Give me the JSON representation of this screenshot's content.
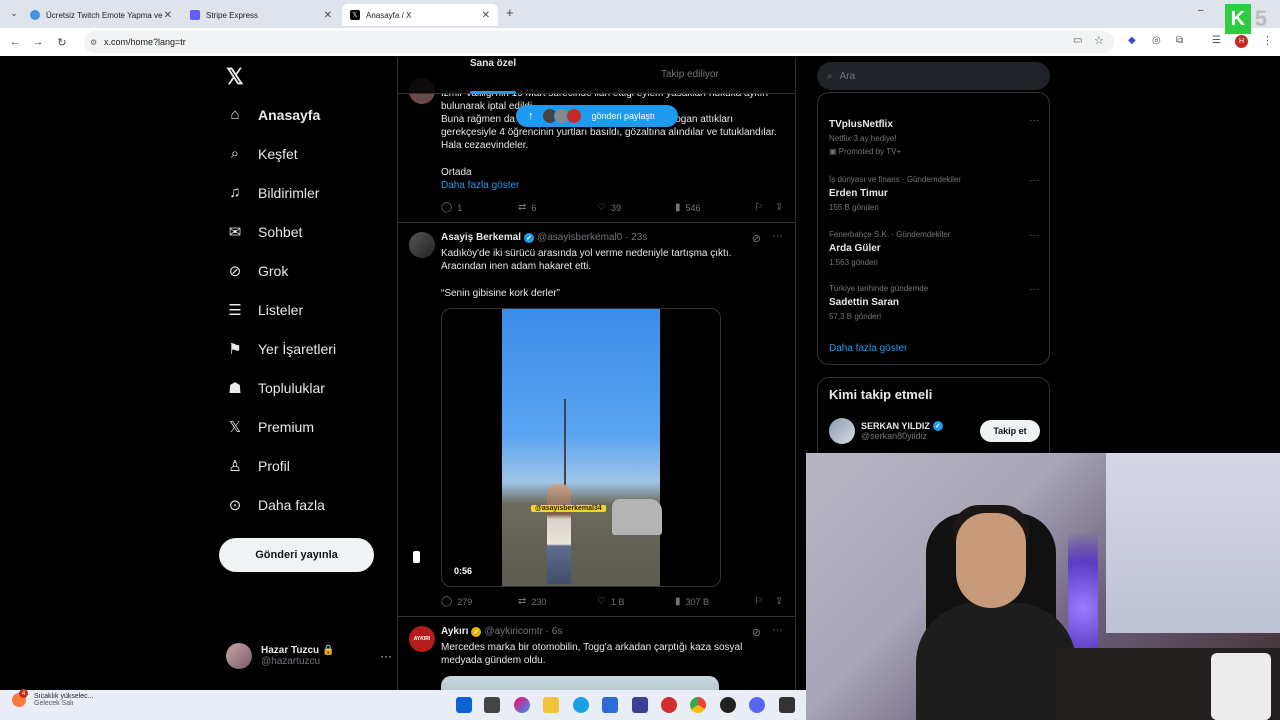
{
  "browser": {
    "tabs": [
      {
        "title": "Ücretsiz Twitch Emote Yapma ve",
        "color": "#9146ff"
      },
      {
        "title": "Stripe Express",
        "color": "#635bff"
      },
      {
        "title": "Anasayfa / X",
        "color": "#000000"
      }
    ],
    "new_tab": "+",
    "url": "x.com/home?lang=tr",
    "profile_letter": "H",
    "window_controls": [
      "–",
      "▢",
      "✕"
    ]
  },
  "nav": {
    "logo": "𝕏",
    "items": [
      {
        "label": "Anasayfa",
        "icon": "⌂"
      },
      {
        "label": "Keşfet",
        "icon": "⌕"
      },
      {
        "label": "Bildirimler",
        "icon": "🔔"
      },
      {
        "label": "Sohbet",
        "icon": "✉"
      },
      {
        "label": "Grok",
        "icon": "◌"
      },
      {
        "label": "Listeler",
        "icon": "☰"
      },
      {
        "label": "Yer İşaretleri",
        "icon": "🔖"
      },
      {
        "label": "Topluluklar",
        "icon": "👥"
      },
      {
        "label": "Premium",
        "icon": "𝕏"
      },
      {
        "label": "Profil",
        "icon": "👤"
      },
      {
        "label": "Daha fazla",
        "icon": "⋯"
      }
    ],
    "post_button": "Gönderi yayınla",
    "profile": {
      "name": "Hazar Tuzcu 🔒",
      "handle": "@hazartuzcu",
      "more": "···"
    }
  },
  "timeline": {
    "tabs": [
      "Sana özel",
      "Takip ediliyor"
    ],
    "new_posts_pill": "gönderi paylaştı",
    "tweet1": {
      "line0": "İzmir Valiliği'nin 19 Mart sürecinde ilan ettiği eylem yasakları hukuka aykırı",
      "line1": "bulunarak iptal edildi.",
      "line2a": "Buna rağmen da",
      "line2b": "slogan attıkları",
      "line3": "gerekçesiyle 4 öğrencinin yurtları basıldı, gözaltına alındılar ve tutuklandılar.",
      "line4": "Hala cezaevindeler.",
      "line5": "Ortada",
      "show_more": "Daha fazla göster",
      "replies": "1",
      "retweets": "6",
      "likes": "39",
      "views": "546"
    },
    "tweet2": {
      "name": "Asayiş Berkemal",
      "handle": "@asayisberkemal0 · 23s",
      "line1": "Kadıköy'de iki sürücü arasında yol verme nedeniyle tartışma çıktı.",
      "line2": "Aracından inen adam hakaret etti.",
      "quote": "“Senin gibisine kork derler”",
      "video_watermark": "@asayisberkemal34",
      "video_time": "0:56",
      "replies": "279",
      "retweets": "230",
      "likes": "1 B",
      "views": "307 B"
    },
    "tweet3": {
      "name": "Aykırı",
      "handle": "@aykiricomtr · 6s",
      "line1": "Mercedes marka bir otomobilin, Togg'a arkadan çarptığı kaza sosyal",
      "line2": "medyada gündem oldu.",
      "avatar_text": "AYKIRI"
    }
  },
  "right": {
    "search_placeholder": "Ara",
    "trends": [
      {
        "ctx": "",
        "title": "TVplusNetflix",
        "count": "Netflix 3 ay hediye!",
        "extra": "Promoted by TV+"
      },
      {
        "ctx": "İş dünyası ve finans · Gündemdekiler",
        "title": "Erden Timur",
        "count": "155 B gönderi"
      },
      {
        "ctx": "Fenerbahçe S.K. · Gündemdekiler",
        "title": "Arda Güler",
        "count": "1.563 gönderi"
      },
      {
        "ctx": "Türkiye tarihinde gündemde",
        "title": "Sadettin Saran",
        "count": "57,3 B gönderi"
      }
    ],
    "show_more": "Daha fazla göster",
    "who_to_follow": {
      "title": "Kimi takip etmeli",
      "name": "SERKAN YILDIZ",
      "handle": "@serkan80yildiz",
      "button": "Takip et"
    }
  },
  "taskbar": {
    "weather_line1": "Sıcaklık yükselec...",
    "weather_line2": "Gelecek Salı",
    "weather_badge": "4"
  },
  "overlay": {
    "k_letter": "K",
    "k_number": "5"
  }
}
